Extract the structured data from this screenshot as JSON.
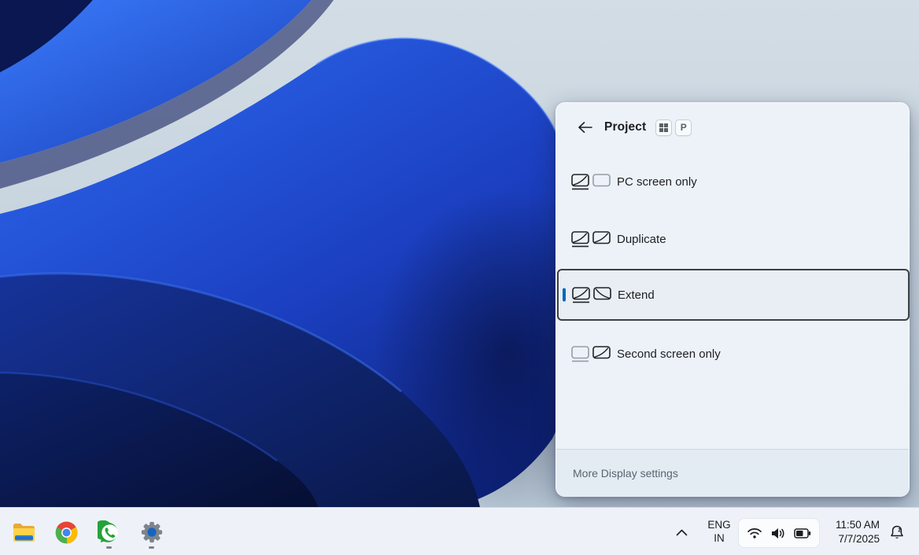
{
  "panel": {
    "title": "Project",
    "shortcut": {
      "windows_key_icon": "win-logo",
      "p_key": "P"
    },
    "options": [
      {
        "label": "PC screen only",
        "selected": false
      },
      {
        "label": "Duplicate",
        "selected": false
      },
      {
        "label": "Extend",
        "selected": true
      },
      {
        "label": "Second screen only",
        "selected": false
      }
    ],
    "footer_link": "More Display settings"
  },
  "taskbar": {
    "apps": [
      {
        "name": "file-explorer",
        "running": false
      },
      {
        "name": "chrome",
        "running": false
      },
      {
        "name": "whatsapp",
        "running": true
      },
      {
        "name": "settings",
        "running": true
      }
    ],
    "tray": {
      "language": {
        "line1": "ENG",
        "line2": "IN"
      },
      "clock": {
        "time": "11:50 AM",
        "date": "7/7/2025"
      },
      "icons": [
        "chevron-up",
        "wifi",
        "volume",
        "battery",
        "bell-do-not-disturb"
      ]
    }
  },
  "colors": {
    "accent": "#0067c0",
    "selection_border": "#3c4046",
    "panel_bg": "#edf2f9",
    "panel_footer_bg": "#e3ebf3",
    "taskbar_bg": "#eef2f8",
    "desktop_light": "#c9d6e0",
    "bloom_bright": "#2e72f5",
    "bloom_dark": "#091747"
  }
}
